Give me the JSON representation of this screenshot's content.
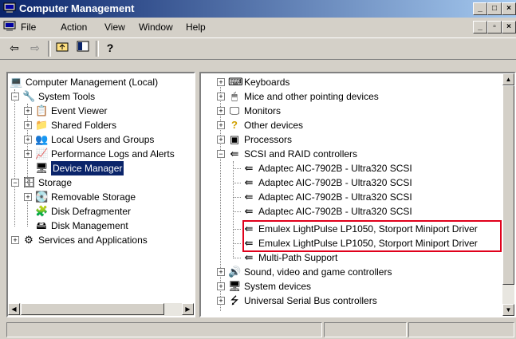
{
  "window": {
    "title": "Computer Management"
  },
  "menu": {
    "file": "File",
    "action": "Action",
    "view": "View",
    "window": "Window",
    "help": "Help"
  },
  "left_tree": {
    "root": "Computer Management (Local)",
    "system_tools": "System Tools",
    "event_viewer": "Event Viewer",
    "shared_folders": "Shared Folders",
    "local_users": "Local Users and Groups",
    "perf_logs": "Performance Logs and Alerts",
    "device_manager": "Device Manager",
    "storage": "Storage",
    "removable_storage": "Removable Storage",
    "disk_defrag": "Disk Defragmenter",
    "disk_mgmt": "Disk Management",
    "services": "Services and Applications"
  },
  "devices": {
    "keyboards": "Keyboards",
    "mice": "Mice and other pointing devices",
    "monitors": "Monitors",
    "other": "Other devices",
    "processors": "Processors",
    "scsi": "SCSI and RAID controllers",
    "adaptec1": "Adaptec AIC-7902B - Ultra320 SCSI",
    "adaptec2": "Adaptec AIC-7902B - Ultra320 SCSI",
    "adaptec3": "Adaptec AIC-7902B - Ultra320 SCSI",
    "adaptec4": "Adaptec AIC-7902B - Ultra320 SCSI",
    "emulex1": "Emulex LightPulse LP1050, Storport Miniport Driver",
    "emulex2": "Emulex LightPulse LP1050, Storport Miniport Driver",
    "multipath": "Multi-Path Support",
    "sound": "Sound, video and game controllers",
    "system_devices": "System devices",
    "usb": "Universal Serial Bus controllers"
  },
  "colors": {
    "highlight_box": "#e0001b",
    "title_start": "#0a246a",
    "title_end": "#a6caf0",
    "selection": "#0a246a"
  }
}
